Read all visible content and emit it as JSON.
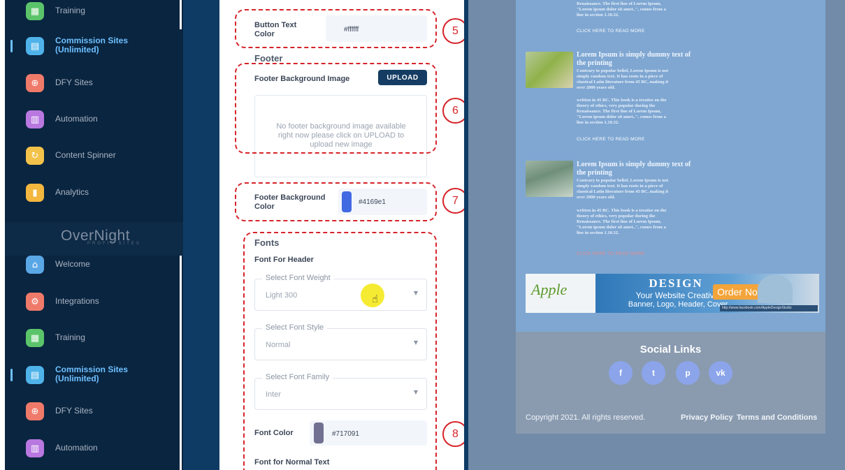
{
  "sidebar": {
    "items_top": [
      {
        "label": "Training",
        "icon": "training-icon",
        "color": "#5bc46a",
        "glyph": "▦"
      },
      {
        "label": "Commission Sites (Unlimited)",
        "icon": "commission-sites-icon",
        "color": "#4fb3ea",
        "glyph": "▤"
      },
      {
        "label": "DFY Sites",
        "icon": "dfy-sites-icon",
        "color": "#f07a6a",
        "glyph": "⊕"
      },
      {
        "label": "Automation",
        "icon": "automation-icon",
        "color": "#b878e0",
        "glyph": "▥"
      },
      {
        "label": "Content Spinner",
        "icon": "content-spinner-icon",
        "color": "#f2c24a",
        "glyph": "↻"
      },
      {
        "label": "Analytics",
        "icon": "analytics-icon",
        "color": "#f3b63e",
        "glyph": "▮"
      }
    ],
    "logo": {
      "main": "OverNight",
      "sub": "PROFIT SITES"
    },
    "items_bottom": [
      {
        "label": "Welcome",
        "icon": "welcome-icon",
        "color": "#5aa7e6",
        "glyph": "⌂"
      },
      {
        "label": "Integrations",
        "icon": "integrations-icon",
        "color": "#f07a6a",
        "glyph": "⚙"
      },
      {
        "label": "Training",
        "icon": "training-icon",
        "color": "#5bc46a",
        "glyph": "▦"
      },
      {
        "label": "Commission Sites (Unlimited)",
        "icon": "commission-sites-icon",
        "color": "#4fb3ea",
        "glyph": "▤"
      },
      {
        "label": "DFY Sites",
        "icon": "dfy-sites-icon",
        "color": "#f07a6a",
        "glyph": "⊕"
      },
      {
        "label": "Automation",
        "icon": "automation-icon",
        "color": "#b878e0",
        "glyph": "▥"
      }
    ]
  },
  "form": {
    "button_text_color": {
      "label": "Button Text Color",
      "value": "#ffffff"
    },
    "footer_section": "Footer",
    "footer_bg_image": {
      "label": "Footer Background Image",
      "button": "UPLOAD",
      "empty_text": "No footer background image available right now please click on UPLOAD to upload new image"
    },
    "footer_bg_color": {
      "label": "Footer Background Color",
      "value": "#4169e1",
      "swatch": "#4169e1"
    },
    "fonts_section": "Fonts",
    "font_for_header": "Font For Header",
    "font_weight": {
      "label": "Select Font Weight",
      "value": "Light 300"
    },
    "font_style": {
      "label": "Select Font Style",
      "value": "Normal"
    },
    "font_family": {
      "label": "Select Font Family",
      "value": "Inter"
    },
    "font_color": {
      "label": "Font Color",
      "value": "#717091",
      "swatch": "#717091"
    },
    "font_for_normal_text": "Font for Normal Text"
  },
  "annotations": [
    "5",
    "6",
    "7",
    "8"
  ],
  "preview": {
    "top_text_1": "Renaissance. The first line of Lorem Ipsum,",
    "top_text_2": "\"Lorem ipsum dolor sit amet..\", comes from a",
    "top_text_3": "line in section 1.10.32.",
    "read_more": "CLICK HERE TO READ MORE",
    "posts": [
      {
        "title_1": "Lorem Ipsum is simply dummy text of",
        "title_2": "the printing",
        "text_a": [
          "Contrary to popular belief, Lorem Ipsum is not",
          "simply random text. It has roots in a piece of",
          "classical Latin literature from 45 BC, making it",
          "over 2000 years old."
        ],
        "text_b": [
          "written in 45 BC. This book is a treatise on the",
          "theory of ethics, very popular during the",
          "Renaissance. The first line of Lorem Ipsum,",
          "\"Lorem ipsum dolor sit amet..\", comes from a",
          "line in section 1.10.32."
        ],
        "link": "CLICK HERE TO READ MORE"
      },
      {
        "title_1": "Lorem Ipsum is simply dummy text of",
        "title_2": "the printing",
        "text_a": [
          "Contrary to popular belief, Lorem Ipsum is not",
          "simply random text. It has roots in a piece of",
          "classical Latin literature from 45 BC, making it",
          "over 2000 years old."
        ],
        "text_b": [
          "written in 45 BC. This book is a treatise on the",
          "theory of ethics, very popular during the",
          "Renaissance. The first line of Lorem Ipsum,",
          "\"Lorem ipsum dolor sit amet..\", comes from a",
          "line in section 1.10.32."
        ],
        "link": "CLICK HERE TO READ MORE"
      }
    ],
    "banner": {
      "brand": "Apple",
      "design": "DESIGN",
      "line1": "Your Website Creative",
      "line2": "Banner, Logo, Header, Cover",
      "cta": "Order Now",
      "url": "http://www.facebook.com/AppleDesignStudio"
    },
    "social_title": "Social Links",
    "social_icons": [
      "f",
      "t",
      "p",
      "vk"
    ],
    "copyright": "Copyright 2021. All rights reserved.",
    "privacy": "Privacy Policy",
    "terms": "Terms and Conditions"
  }
}
